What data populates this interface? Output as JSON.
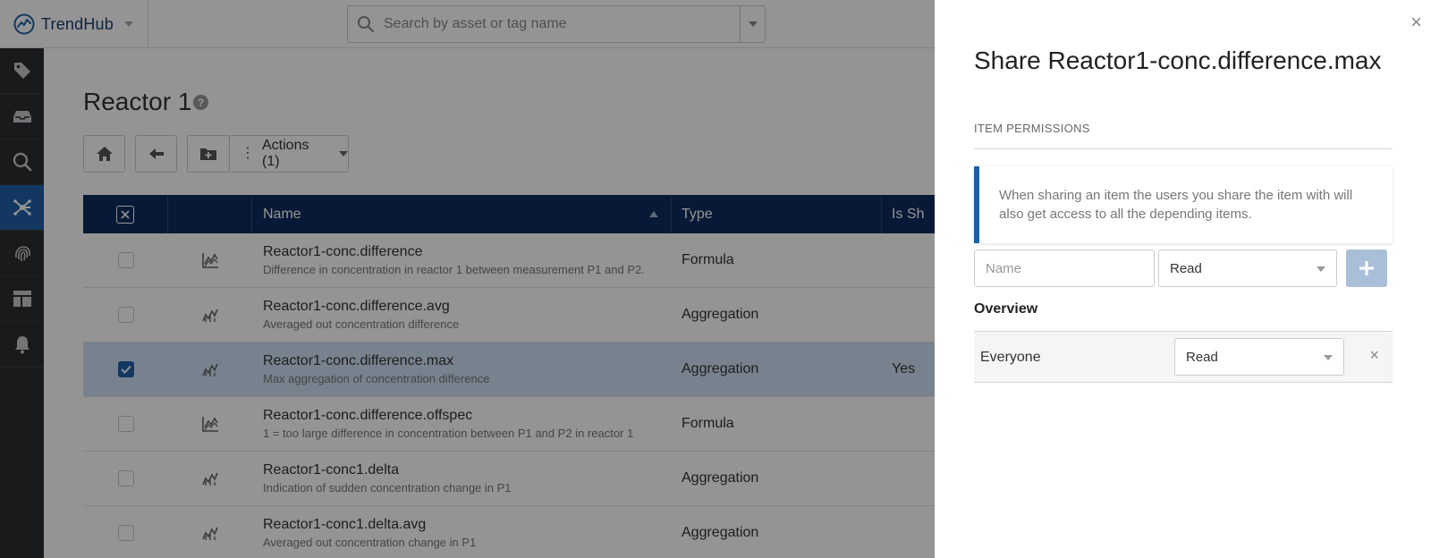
{
  "brand": {
    "name": "TrendHub"
  },
  "search": {
    "placeholder": "Search by asset or tag name"
  },
  "sidebar": {
    "items": [
      {
        "icon": "tag-icon"
      },
      {
        "icon": "inbox-icon"
      },
      {
        "icon": "search-icon"
      },
      {
        "icon": "network-icon",
        "active": true
      },
      {
        "icon": "fingerprint-icon"
      },
      {
        "icon": "dashboard-icon"
      },
      {
        "icon": "bell-icon"
      }
    ]
  },
  "page": {
    "title": "Reactor 1",
    "help": "?"
  },
  "toolbar": {
    "actions_label": "Actions (1)"
  },
  "table": {
    "headers": {
      "name": "Name",
      "type": "Type",
      "shared": "Is Sh"
    },
    "rows": [
      {
        "name": "Reactor1-conc.difference",
        "desc": "Difference in concentration in reactor 1 between measurement P1 and P2.",
        "type": "Formula",
        "shared": "",
        "checked": false,
        "icon": "formula-icon"
      },
      {
        "name": "Reactor1-conc.difference.avg",
        "desc": "Averaged out concentration difference",
        "type": "Aggregation",
        "shared": "",
        "checked": false,
        "icon": "aggregation-icon"
      },
      {
        "name": "Reactor1-conc.difference.max",
        "desc": "Max aggregation of concentration difference",
        "type": "Aggregation",
        "shared": "Yes",
        "checked": true,
        "icon": "aggregation-icon"
      },
      {
        "name": "Reactor1-conc.difference.offspec",
        "desc": "1 = too large difference in concentration between P1 and P2 in reactor 1",
        "type": "Formula",
        "shared": "",
        "checked": false,
        "icon": "formula-icon"
      },
      {
        "name": "Reactor1-conc1.delta",
        "desc": "Indication of sudden concentration change in P1",
        "type": "Aggregation",
        "shared": "",
        "checked": false,
        "icon": "aggregation-icon"
      },
      {
        "name": "Reactor1-conc1.delta.avg",
        "desc": "Averaged out concentration change in P1",
        "type": "Aggregation",
        "shared": "",
        "checked": false,
        "icon": "aggregation-icon"
      }
    ]
  },
  "share": {
    "title": "Share Reactor1-conc.difference.max",
    "section_label": "ITEM PERMISSIONS",
    "info": "When sharing an item the users you share the item with will also get access to all the depending items.",
    "name_placeholder": "Name",
    "permission_value": "Read",
    "overview_title": "Overview",
    "overview": [
      {
        "name": "Everyone",
        "permission": "Read"
      }
    ]
  },
  "colors": {
    "accent": "#1f5fa8",
    "header": "#0d2b5e",
    "sidebar": "#2b2d31"
  }
}
